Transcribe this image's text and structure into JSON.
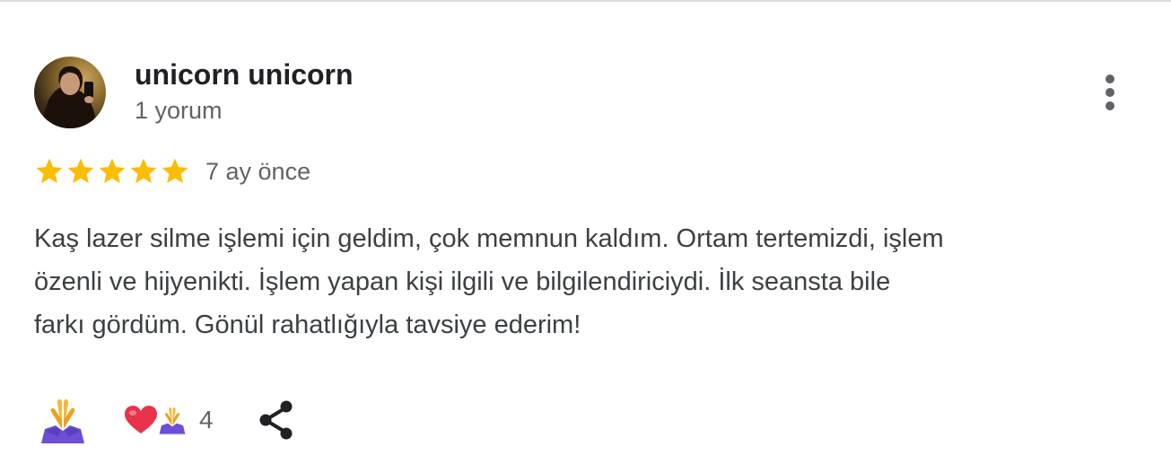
{
  "review": {
    "author_name": "unicorn unicorn",
    "author_review_count": "1 yorum",
    "rating": 5,
    "rating_max": 5,
    "time_ago": "7 ay önce",
    "text_lines": [
      "Kaş lazer silme işlemi için geldim, çok memnun kaldım. Ortam tertemizdi, işlem",
      "özenli ve hijyenikti. İşlem yapan kişi ilgili ve bilgilendiriciydi. İlk seansta bile",
      "farkı gördüm. Gönül rahatlığıyla tavsiye ederim!"
    ],
    "reaction_count": "4"
  },
  "icons": {
    "more": "more-vertical-icon",
    "star": "star-icon",
    "react": "folded-hands-icon",
    "reaction_heart": "heart-icon",
    "reaction_hands": "folded-hands-icon",
    "share": "share-icon"
  },
  "colors": {
    "star": "#fbbc04",
    "text_primary": "#202124",
    "text_secondary": "#5f6368",
    "heart": "#e8334a",
    "hands_skin": "#f6b93b",
    "hands_sleeve": "#6c4fd6"
  }
}
